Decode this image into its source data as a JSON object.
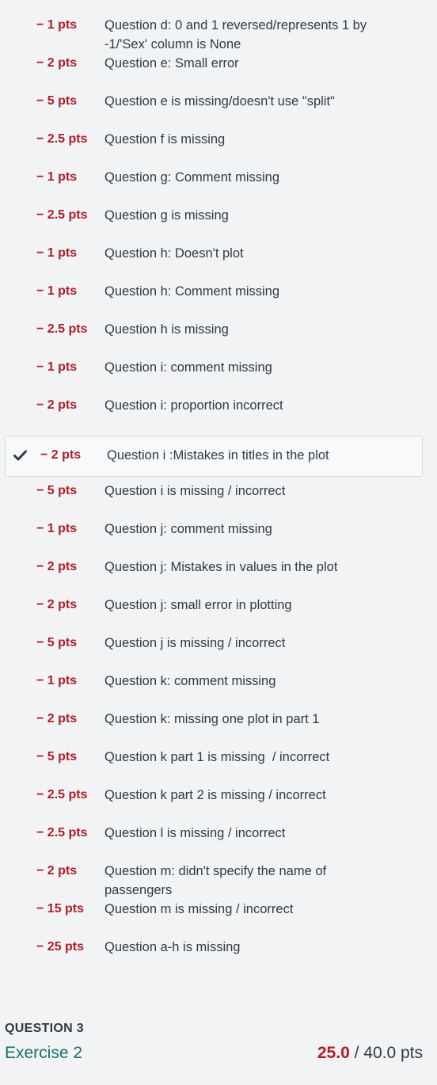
{
  "rubric": [
    {
      "pts": "− 1 pts",
      "desc": "Question d: 0 and 1 reversed/represents 1 by -1/'Sex' column is None",
      "applied": false
    },
    {
      "pts": "− 2 pts",
      "desc": "Question e: Small error",
      "applied": false
    },
    {
      "pts": "− 5 pts",
      "desc": "Question e is missing/doesn't use \"split\"",
      "applied": false
    },
    {
      "pts": "− 2.5 pts",
      "desc": "Question f is missing",
      "applied": false
    },
    {
      "pts": "− 1 pts",
      "desc": "Question g: Comment missing",
      "applied": false
    },
    {
      "pts": "− 2.5 pts",
      "desc": "Question g is missing",
      "applied": false
    },
    {
      "pts": "− 1 pts",
      "desc": "Question h: Doesn't plot",
      "applied": false
    },
    {
      "pts": "− 1 pts",
      "desc": "Question h: Comment missing",
      "applied": false
    },
    {
      "pts": "− 2.5 pts",
      "desc": "Question h is missing",
      "applied": false
    },
    {
      "pts": "− 1 pts",
      "desc": "Question i: comment missing",
      "applied": false
    },
    {
      "pts": "− 2 pts",
      "desc": "Question i: proportion incorrect",
      "applied": false
    },
    {
      "pts": "− 2 pts",
      "desc": "Question i :Mistakes in titles in the plot",
      "applied": true
    },
    {
      "pts": "− 5 pts",
      "desc": "Question i is missing / incorrect",
      "applied": false
    },
    {
      "pts": "− 1 pts",
      "desc": "Question j: comment missing",
      "applied": false
    },
    {
      "pts": "− 2 pts",
      "desc": "Question j: Mistakes in values in the plot",
      "applied": false
    },
    {
      "pts": "− 2 pts",
      "desc": "Question j: small error in plotting",
      "applied": false
    },
    {
      "pts": "− 5 pts",
      "desc": "Question j is missing / incorrect",
      "applied": false
    },
    {
      "pts": "− 1 pts",
      "desc": "Question k: comment missing",
      "applied": false
    },
    {
      "pts": "− 2 pts",
      "desc": "Question k: missing one plot in part 1",
      "applied": false
    },
    {
      "pts": "− 5 pts",
      "desc": "Question k part 1 is missing  / incorrect",
      "applied": false
    },
    {
      "pts": "− 2.5 pts",
      "desc": "Question k part 2 is missing / incorrect",
      "applied": false
    },
    {
      "pts": "− 2.5 pts",
      "desc": "Question l is missing / incorrect",
      "applied": false
    },
    {
      "pts": "− 2 pts",
      "desc": "Question m: didn't specify the name of passengers",
      "applied": false
    },
    {
      "pts": "− 15 pts",
      "desc": "Question m is missing / incorrect",
      "applied": false
    },
    {
      "pts": "− 25 pts",
      "desc": "Question a-h is missing",
      "applied": false
    }
  ],
  "question": {
    "header": "QUESTION 3",
    "title": "Exercise 2",
    "earned": "25.0",
    "separator": " / ",
    "total": "40.0 pts"
  },
  "icons": {
    "applied": "checkmark-icon"
  },
  "colors": {
    "deduction": "#b31c22",
    "title": "#18706e",
    "text": "#2d3b45",
    "background": "#f1f3f4"
  }
}
